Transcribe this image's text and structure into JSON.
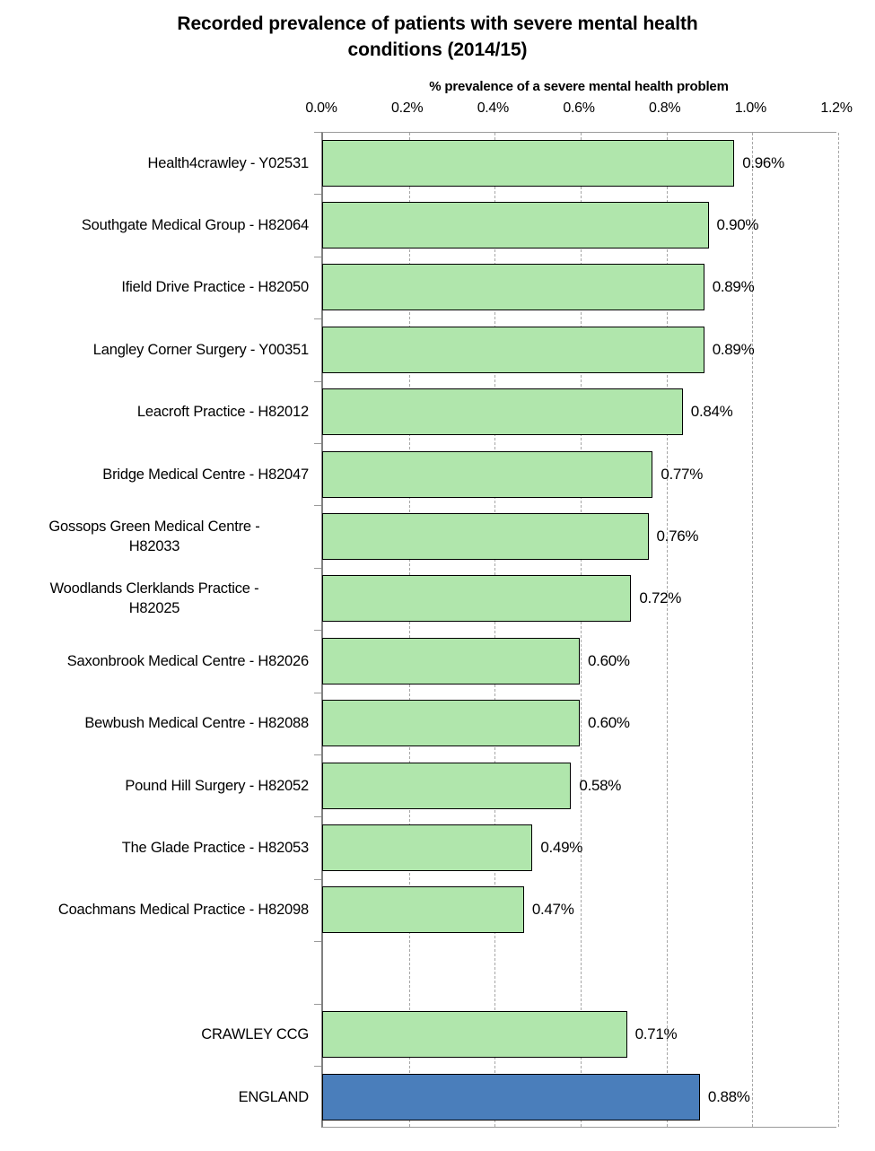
{
  "chart_data": {
    "type": "bar",
    "orientation": "horizontal",
    "title": "Recorded prevalence of patients with severe mental health conditions (2014/15)",
    "title_line1": "Recorded prevalence of patients with severe mental health",
    "title_line2": "conditions (2014/15)",
    "xlabel": "% prevalence of a severe mental health problem",
    "ylabel": "",
    "xlim": [
      0,
      1.2
    ],
    "xticks": [
      "0.0%",
      "0.2%",
      "0.4%",
      "0.6%",
      "0.8%",
      "1.0%",
      "1.2%"
    ],
    "xtick_values": [
      0.0,
      0.2,
      0.4,
      0.6,
      0.8,
      1.0,
      1.2
    ],
    "grid": "vertical-dashed",
    "legend": "none",
    "colors": {
      "practice_bar": "#b0e6ac",
      "ccg_bar": "#b0e6ac",
      "england_bar": "#4a7ebb",
      "bar_outline": "#000000",
      "gridline": "#a6a6a6"
    },
    "categories": [
      "Health4crawley - Y02531",
      "Southgate Medical Group - H82064",
      "Ifield Drive Practice - H82050",
      "Langley Corner Surgery - Y00351",
      "Leacroft Practice - H82012",
      "Bridge Medical Centre - H82047",
      "Gossops Green Medical Centre - H82033",
      "Woodlands Clerklands Practice - H82025",
      "Saxonbrook Medical Centre - H82026",
      "Bewbush Medical Centre - H82088",
      "Pound Hill Surgery - H82052",
      "The Glade Practice - H82053",
      "Coachmans Medical Practice - H82098",
      "",
      "CRAWLEY CCG",
      "ENGLAND"
    ],
    "values": [
      0.96,
      0.9,
      0.89,
      0.89,
      0.84,
      0.77,
      0.76,
      0.72,
      0.6,
      0.6,
      0.58,
      0.49,
      0.47,
      null,
      0.71,
      0.88
    ],
    "value_labels": [
      "0.96%",
      "0.90%",
      "0.89%",
      "0.89%",
      "0.84%",
      "0.77%",
      "0.76%",
      "0.72%",
      "0.60%",
      "0.60%",
      "0.58%",
      "0.49%",
      "0.47%",
      "",
      "0.71%",
      "0.88%"
    ]
  },
  "rows": [
    {
      "label_lines": [
        "Health4crawley - Y02531"
      ],
      "value": 0.96,
      "value_label": "0.96%",
      "series": "practice"
    },
    {
      "label_lines": [
        "Southgate Medical Group - H82064"
      ],
      "value": 0.9,
      "value_label": "0.90%",
      "series": "practice"
    },
    {
      "label_lines": [
        "Ifield Drive Practice - H82050"
      ],
      "value": 0.89,
      "value_label": "0.89%",
      "series": "practice"
    },
    {
      "label_lines": [
        "Langley Corner Surgery - Y00351"
      ],
      "value": 0.89,
      "value_label": "0.89%",
      "series": "practice"
    },
    {
      "label_lines": [
        "Leacroft Practice - H82012"
      ],
      "value": 0.84,
      "value_label": "0.84%",
      "series": "practice"
    },
    {
      "label_lines": [
        "Bridge Medical Centre - H82047"
      ],
      "value": 0.77,
      "value_label": "0.77%",
      "series": "practice"
    },
    {
      "label_lines": [
        "Gossops Green Medical Centre -",
        "H82033"
      ],
      "value": 0.76,
      "value_label": "0.76%",
      "series": "practice"
    },
    {
      "label_lines": [
        "Woodlands Clerklands Practice -",
        "H82025"
      ],
      "value": 0.72,
      "value_label": "0.72%",
      "series": "practice"
    },
    {
      "label_lines": [
        "Saxonbrook Medical Centre - H82026"
      ],
      "value": 0.6,
      "value_label": "0.60%",
      "series": "practice"
    },
    {
      "label_lines": [
        "Bewbush Medical Centre - H82088"
      ],
      "value": 0.6,
      "value_label": "0.60%",
      "series": "practice"
    },
    {
      "label_lines": [
        "Pound Hill Surgery - H82052"
      ],
      "value": 0.58,
      "value_label": "0.58%",
      "series": "practice"
    },
    {
      "label_lines": [
        "The Glade Practice - H82053"
      ],
      "value": 0.49,
      "value_label": "0.49%",
      "series": "practice"
    },
    {
      "label_lines": [
        "Coachmans Medical Practice - H82098"
      ],
      "value": 0.47,
      "value_label": "0.47%",
      "series": "practice"
    },
    {
      "label_lines": [
        ""
      ],
      "value": null,
      "value_label": "",
      "series": "blank"
    },
    {
      "label_lines": [
        "CRAWLEY CCG"
      ],
      "value": 0.71,
      "value_label": "0.71%",
      "series": "ccg"
    },
    {
      "label_lines": [
        "ENGLAND"
      ],
      "value": 0.88,
      "value_label": "0.88%",
      "series": "england"
    }
  ]
}
